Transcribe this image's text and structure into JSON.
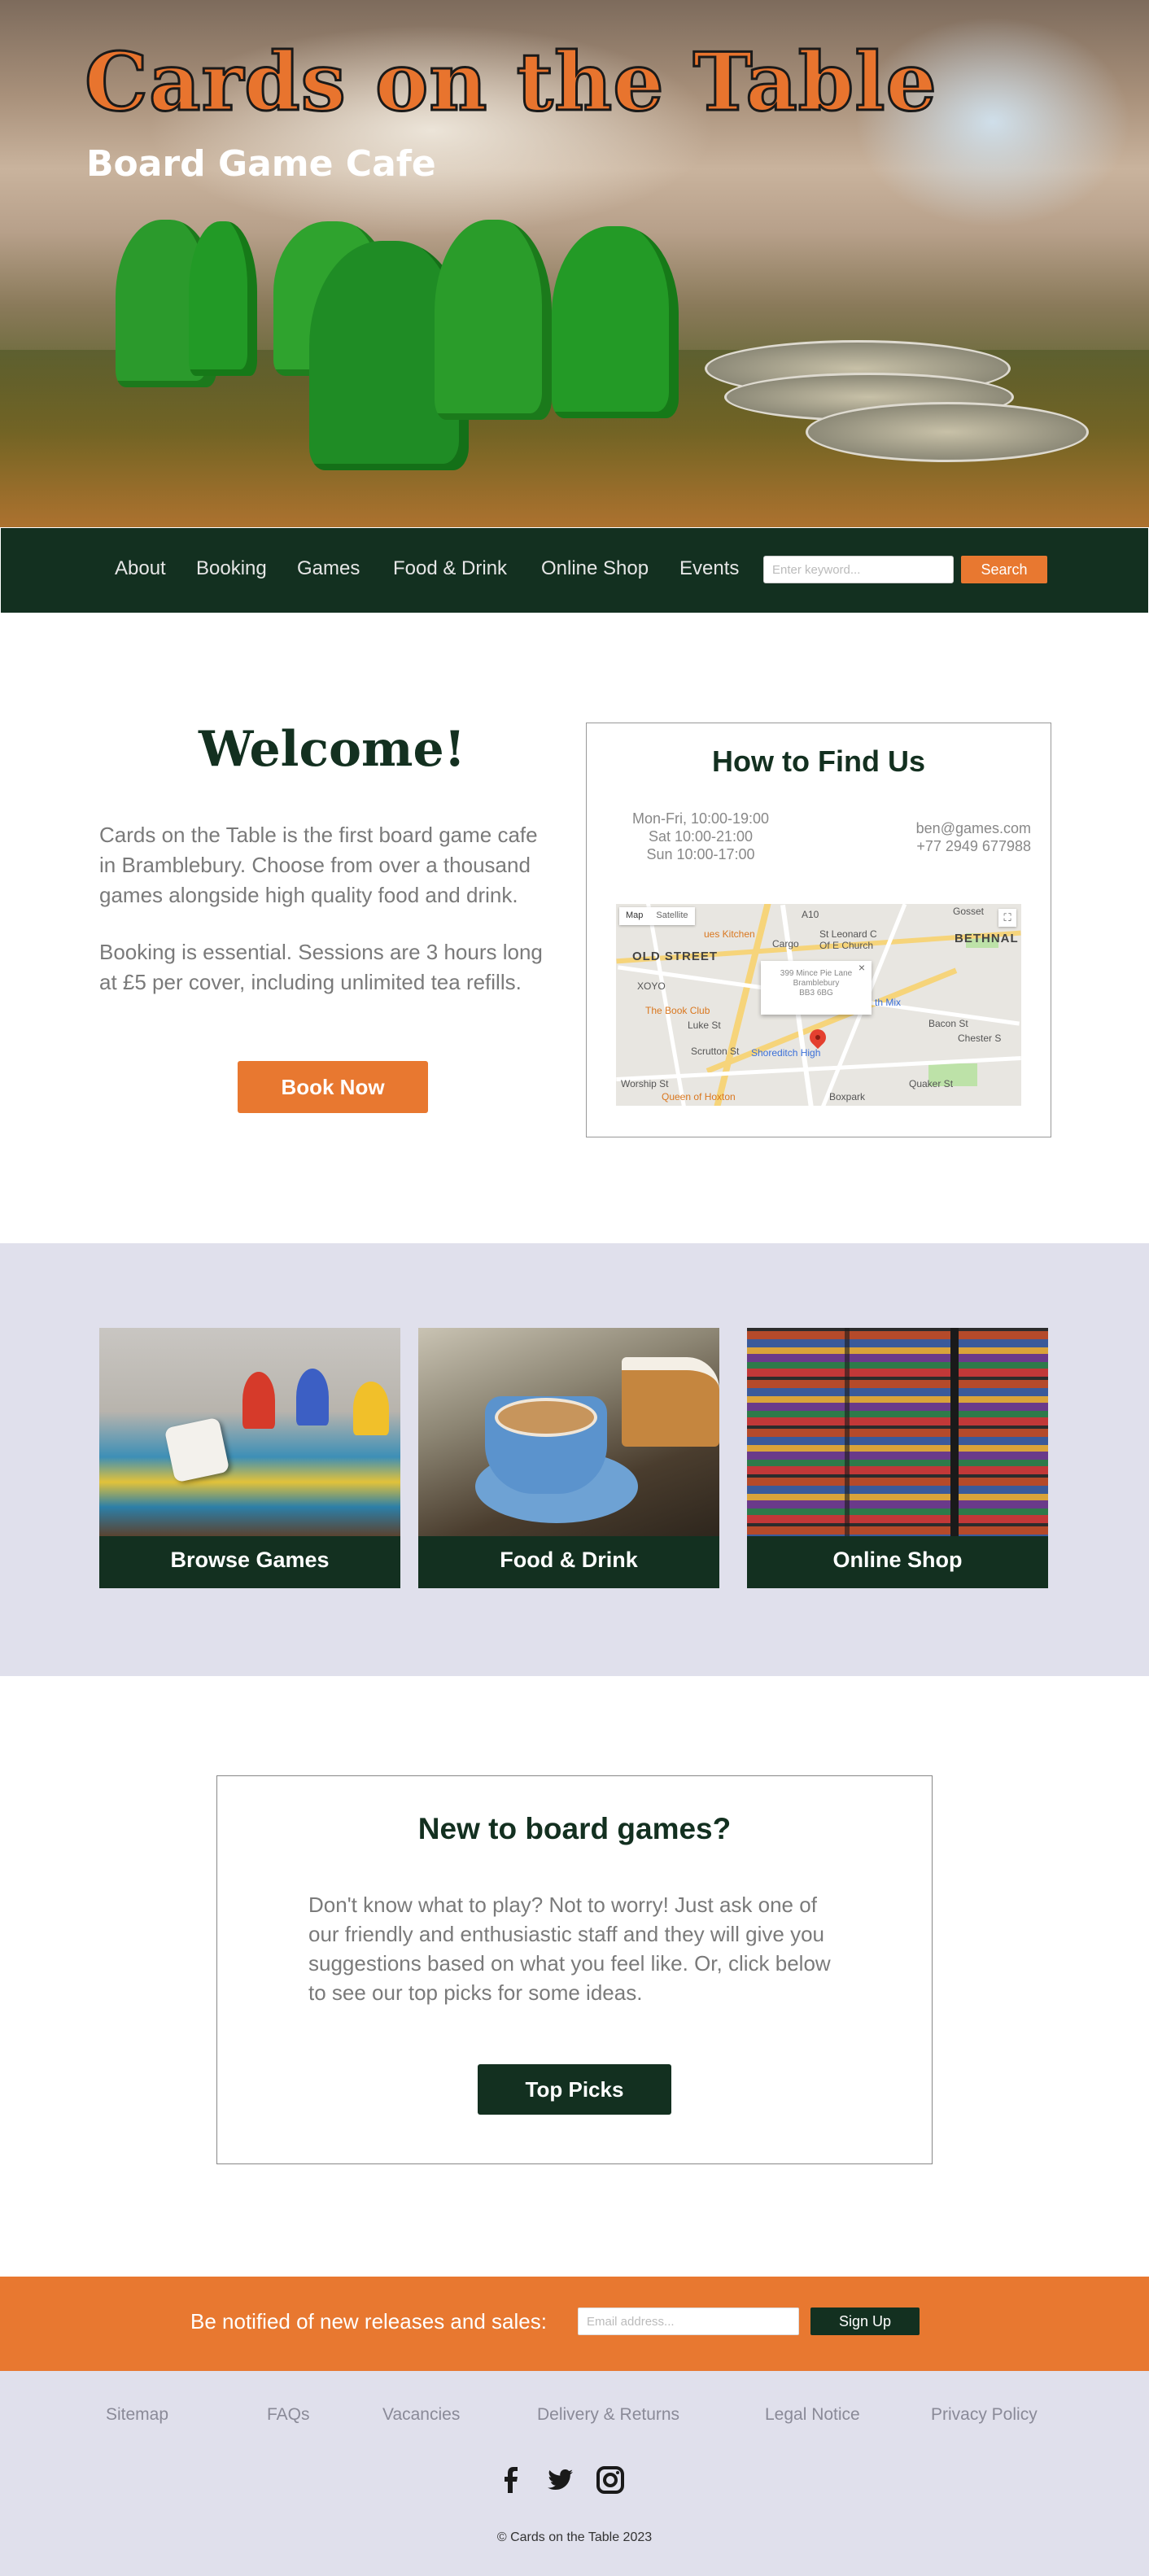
{
  "hero": {
    "title": "Cards on the Table",
    "subtitle": "Board Game Cafe"
  },
  "nav": {
    "items": [
      {
        "label": "About"
      },
      {
        "label": "Booking"
      },
      {
        "label": "Games"
      },
      {
        "label": "Food & Drink"
      },
      {
        "label": "Online Shop"
      },
      {
        "label": "Events"
      }
    ],
    "search_placeholder": "Enter keyword...",
    "search_label": "Search"
  },
  "welcome": {
    "title": "Welcome!",
    "para1": "Cards on the Table is the first board game cafe in Bramblebury. Choose from over a thousand games alongside high quality food and drink.",
    "para2": "Booking is essential. Sessions are 3 hours long at £5 per cover, including unlimited tea refills.",
    "book_label": "Book Now"
  },
  "find_us": {
    "title": "How to Find Us",
    "hours": [
      "Mon-Fri, 10:00-19:00",
      "Sat 10:00-21:00",
      "Sun 10:00-17:00"
    ],
    "email": "ben@games.com",
    "phone": "+77 2949 677988",
    "map": {
      "type_map": "Map",
      "type_satellite": "Satellite",
      "info_lines": [
        "399 Mince Pie Lane",
        "Bramblebury",
        "BB3 6BG"
      ],
      "labels": {
        "old_street": "OLD STREET",
        "bethnal": "BETHNAL",
        "xoyo": "XOYO",
        "book_club": "The Book Club",
        "cargo": "Cargo",
        "st_leonard": "St Leonard C",
        "st_leonard2": "Of E Church",
        "kitchen": "ues Kitchen",
        "queen_hoxton": "Queen of Hoxton",
        "boxpark": "Boxpark",
        "worship": "Worship St",
        "scrutton": "Scrutton St",
        "luke": "Luke St",
        "gosset": "Gosset",
        "chesham": "Chester S",
        "bacon": "Bacon St",
        "quaker": "Quaker St",
        "a10": "A10",
        "mix": "th Mix",
        "shoreditch": "Shoreditch High"
      }
    }
  },
  "cards": [
    {
      "label": "Browse Games",
      "image": "board-game-pieces-and-dice"
    },
    {
      "label": "Food & Drink",
      "image": "latte-and-cake"
    },
    {
      "label": "Online Shop",
      "image": "shelves-of-board-games"
    }
  ],
  "new_to_games": {
    "title": "New to board games?",
    "text": "Don't know what to play? Not to worry! Just ask one of our friendly and enthusiastic staff and they will give you suggestions based on what you feel like. Or, click below to see our top picks for some ideas.",
    "button": "Top Picks"
  },
  "newsletter": {
    "label": "Be notified of new releases and sales:",
    "placeholder": "Email address...",
    "button": "Sign Up"
  },
  "footer": {
    "links": [
      {
        "label": "Sitemap"
      },
      {
        "label": "FAQs"
      },
      {
        "label": "Vacancies"
      },
      {
        "label": "Delivery & Returns"
      },
      {
        "label": "Legal Notice"
      },
      {
        "label": "Privacy Policy"
      }
    ],
    "social": [
      "facebook-icon",
      "twitter-icon",
      "instagram-icon"
    ],
    "copyright": "© Cards on the Table 2023"
  },
  "colors": {
    "accent": "#e87830",
    "dark_green": "#133020",
    "lavender": "#e0e0ec"
  }
}
